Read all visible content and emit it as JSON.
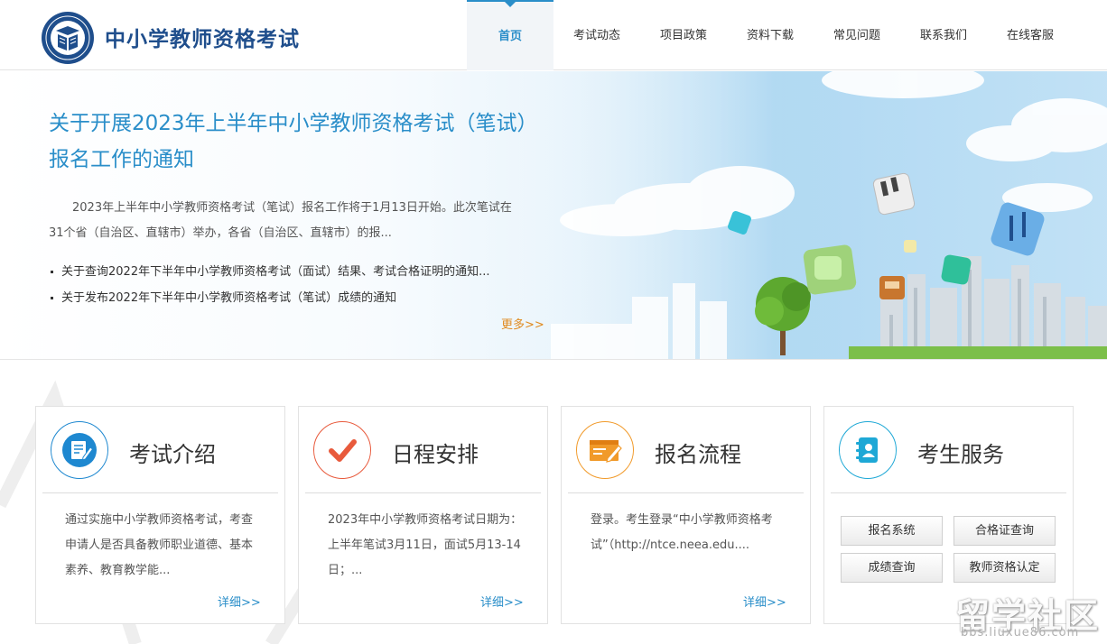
{
  "header": {
    "site_title": "中小学教师资格考试",
    "nav": [
      {
        "label": "首页",
        "active": true
      },
      {
        "label": "考试动态"
      },
      {
        "label": "项目政策"
      },
      {
        "label": "资料下载"
      },
      {
        "label": "常见问题"
      },
      {
        "label": "联系我们"
      },
      {
        "label": "在线客服"
      }
    ]
  },
  "banner": {
    "headline": "关于开展2023年上半年中小学教师资格考试（笔试）报名工作的通知",
    "summary": "2023年上半年中小学教师资格考试（笔试）报名工作将于1月13日开始。此次笔试在31个省（自治区、直辖市）举办，各省（自治区、直辖市）的报...",
    "news": [
      "关于查询2022年下半年中小学教师资格考试（面试）结果、考试合格证明的通知...",
      "关于发布2022年下半年中小学教师资格考试（笔试）成绩的通知"
    ],
    "more_label": "更多>>"
  },
  "cards": {
    "intro": {
      "title": "考试介绍",
      "text": "通过实施中小学教师资格考试，考查申请人是否具备教师职业道德、基本素养、教育教学能...",
      "more": "详细>>"
    },
    "schedule": {
      "title": "日程安排",
      "text": "2023年中小学教师资格考试日期为：上半年笔试3月11日，面试5月13-14日；...",
      "more": "详细>>"
    },
    "process": {
      "title": "报名流程",
      "text": "登录。考生登录“中小学教师资格考试”（http://ntce.neea.edu....",
      "more": "详细>>"
    },
    "service": {
      "title": "考生服务",
      "buttons": [
        "报名系统",
        "合格证查询",
        "成绩查询",
        "教师资格认定"
      ]
    }
  },
  "watermark": {
    "text": "留学社区",
    "url": "bbs.liuxue86.com"
  },
  "colors": {
    "accent_blue": "#2a8ec9",
    "title_navy": "#1f4e8c",
    "more_orange": "#e08a1e",
    "intro_icon": "#1e88d0",
    "schedule_icon": "#e85a3c",
    "process_icon": "#f19a2a",
    "service_icon": "#1ea8d6"
  },
  "icons": {
    "logo": "exam-emblem-logo",
    "intro": "document-pen-icon",
    "schedule": "checkmark-icon",
    "process": "form-pen-icon",
    "service": "contact-book-icon"
  }
}
